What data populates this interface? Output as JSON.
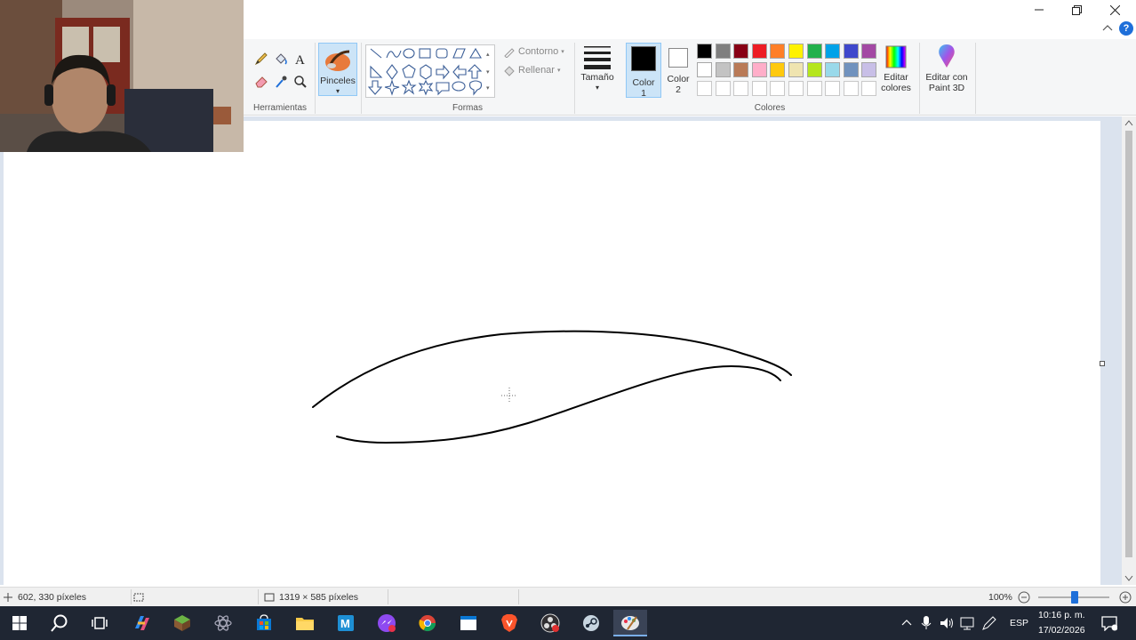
{
  "window": {
    "controls": [
      "minimize",
      "restore",
      "close"
    ]
  },
  "ribbon": {
    "groups": {
      "herramientas": "Herramientas",
      "formas": "Formas",
      "colores": "Colores"
    },
    "pinceles_label": "Pinceles",
    "contorno_label": "Contorno",
    "rellenar_label": "Rellenar",
    "tamano_label": "Tamaño",
    "color1_label": [
      "Color",
      "1"
    ],
    "color2_label": [
      "Color",
      "2"
    ],
    "editar_colores_label": [
      "Editar",
      "colores"
    ],
    "paint3d_label": [
      "Editar con",
      "Paint 3D"
    ],
    "color1_value": "#000000",
    "color2_value": "#ffffff",
    "palette_row1": [
      "#000000",
      "#7f7f7f",
      "#880015",
      "#ed1c24",
      "#ff7f27",
      "#fff200",
      "#22b14c",
      "#00a2e8",
      "#3f48cc",
      "#a349a4"
    ],
    "palette_row2": [
      "#ffffff",
      "#c3c3c3",
      "#b97a57",
      "#ffaec9",
      "#ffc90e",
      "#efe4b0",
      "#b5e61d",
      "#99d9ea",
      "#7092be",
      "#c8bfe7"
    ]
  },
  "statusbar": {
    "cursor_position": "602, 330 píxeles",
    "canvas_size": "1319 × 585 píxeles",
    "zoom": "100%"
  },
  "taskbar": {
    "language": "ESP",
    "time": "10:16 p. m.",
    "date": "17/02/2026"
  }
}
